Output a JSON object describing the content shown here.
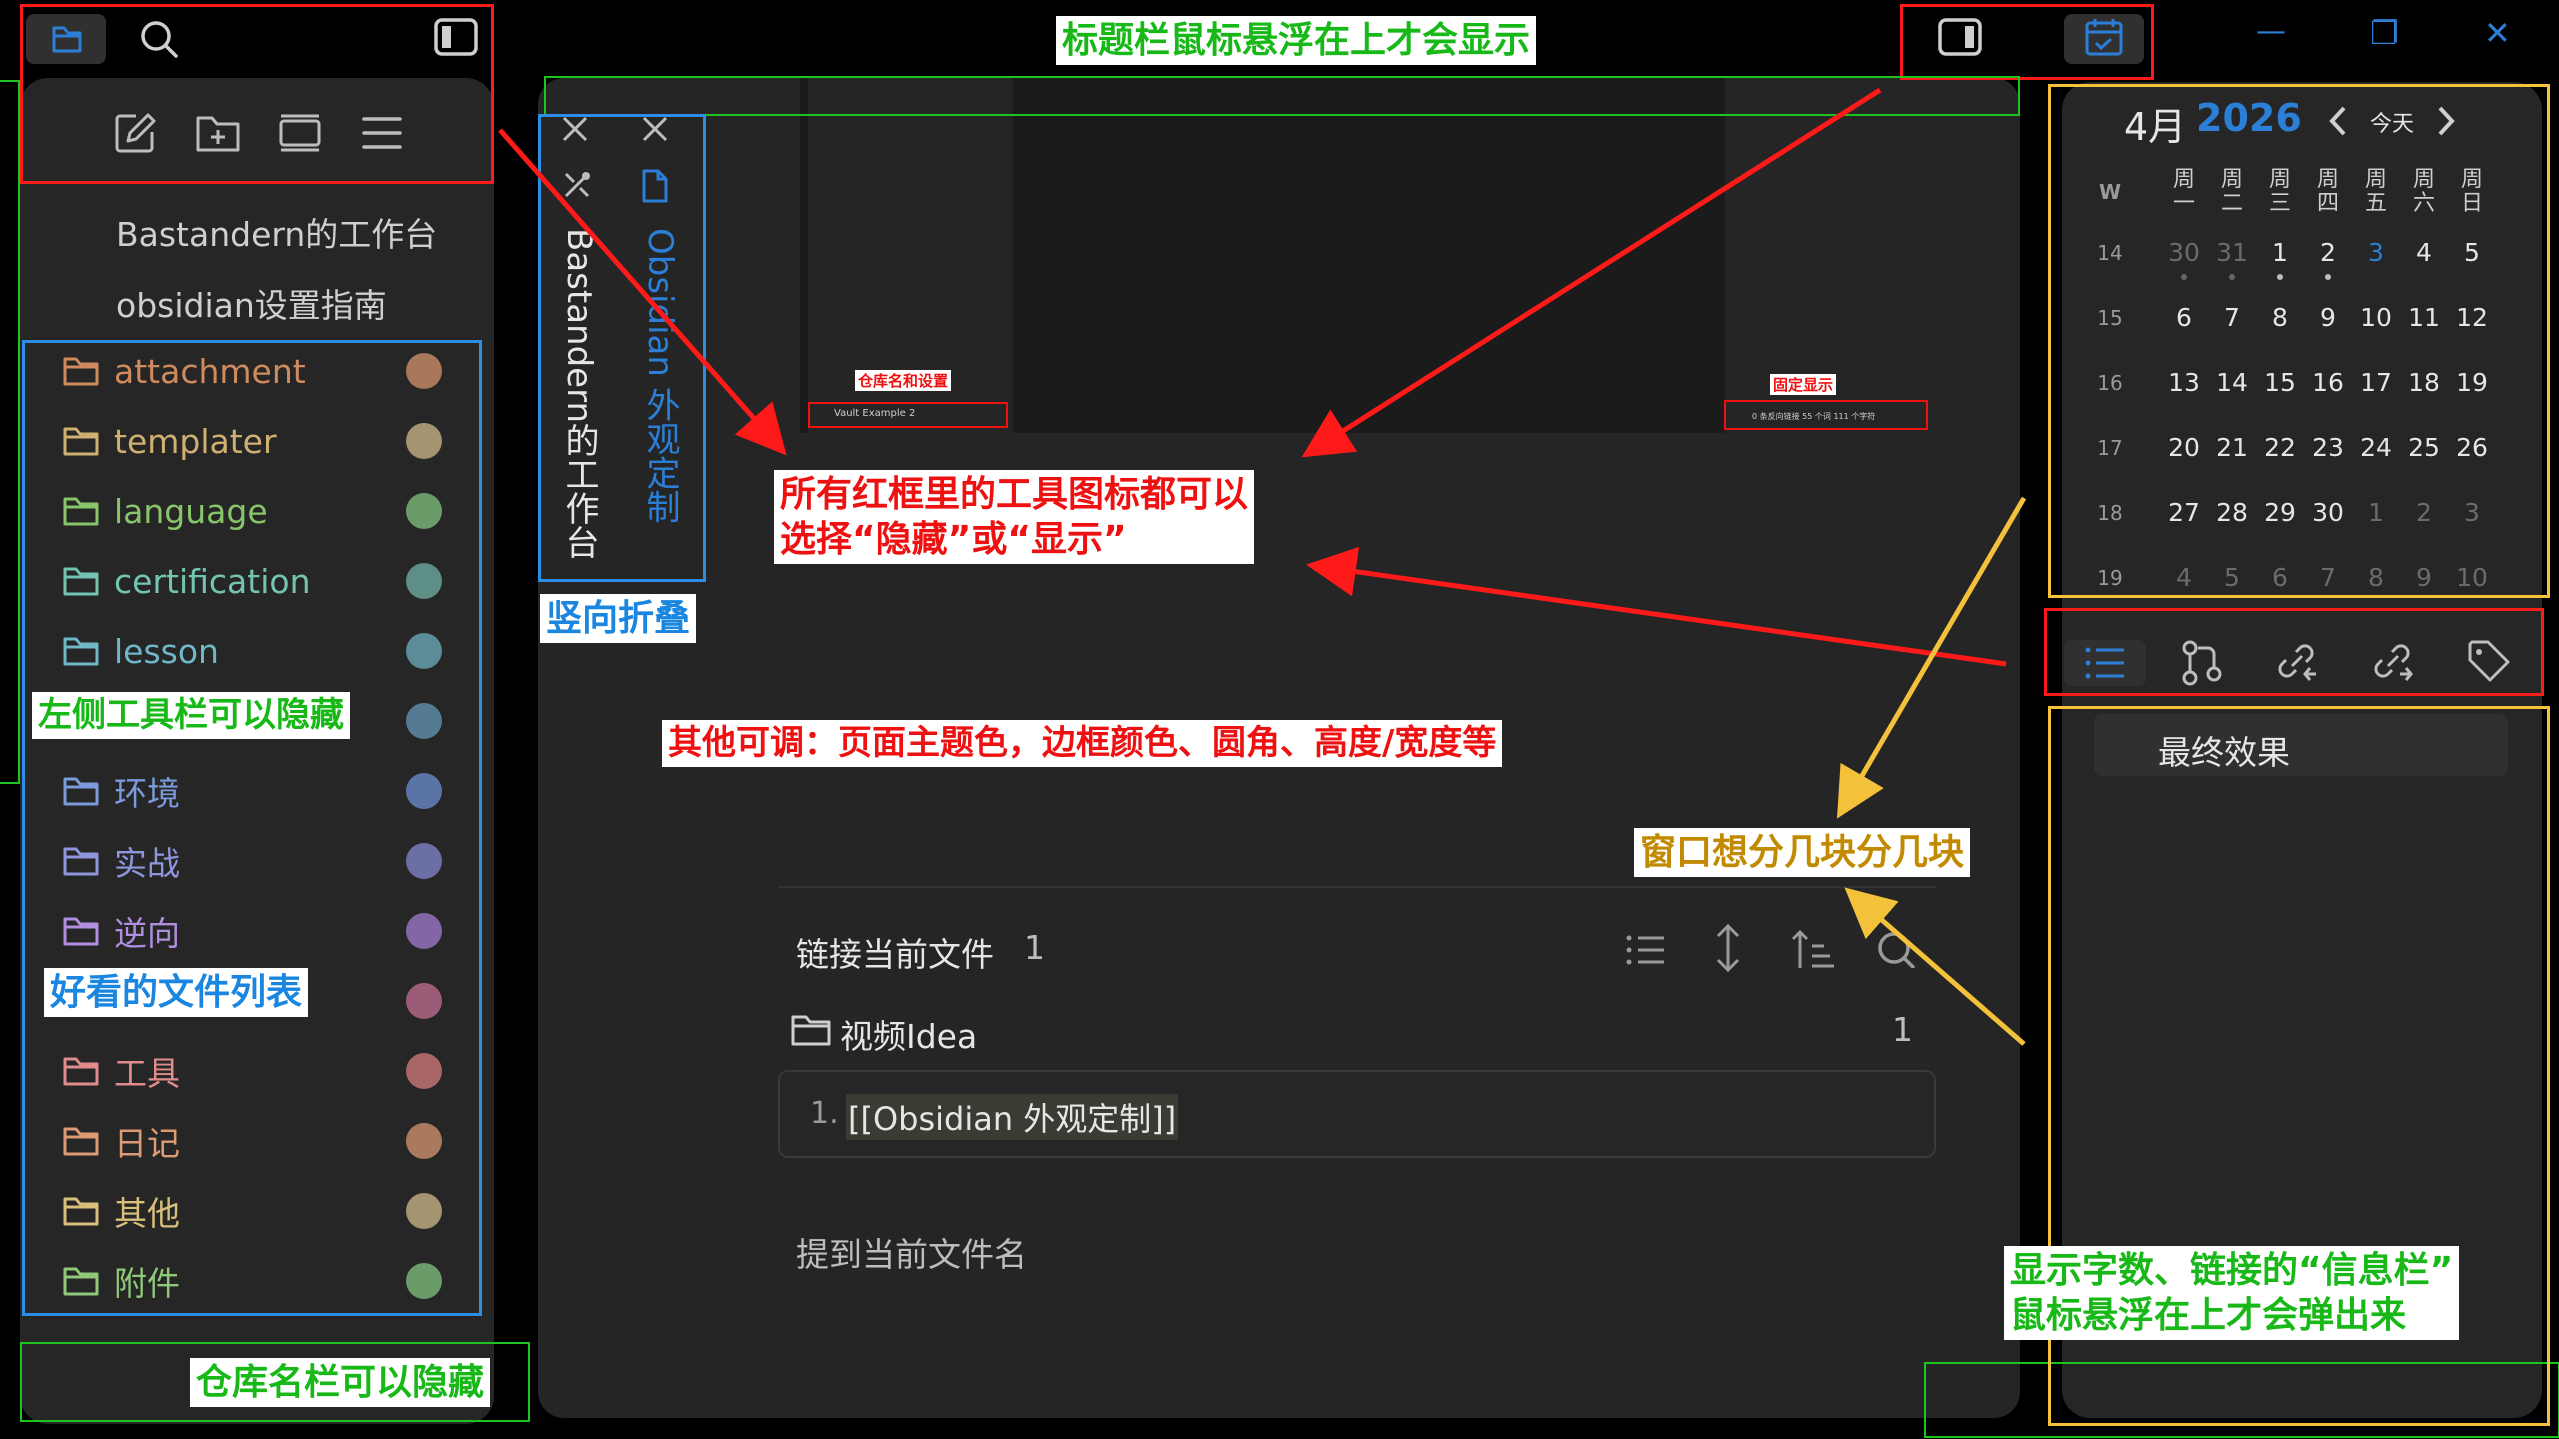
{
  "titlebar_hint": "标题栏鼠标悬浮在上才会显示",
  "window_controls": {
    "minimize": "—",
    "maximize": "❐",
    "close": "✕"
  },
  "left_sidebar": {
    "pinned_files": [
      "Bastandern的工作台",
      "obsidian设置指南"
    ],
    "folders": [
      {
        "name": "attachment",
        "color": "#cf8b5d",
        "dot": "#a9785a"
      },
      {
        "name": "templater",
        "color": "#cfb070",
        "dot": "#a49472"
      },
      {
        "name": "language",
        "color": "#88c46a",
        "dot": "#6c9b6a"
      },
      {
        "name": "certification",
        "color": "#73c4b0",
        "dot": "#5e8f87"
      },
      {
        "name": "lesson",
        "color": "#6fb7c9",
        "dot": "#5b8c98"
      },
      {
        "name": "",
        "color": "#6aa4c9",
        "dot": "#557a93"
      },
      {
        "name": "环境",
        "color": "#7b9bdc",
        "dot": "#5b74a8"
      },
      {
        "name": "实战",
        "color": "#8f96de",
        "dot": "#6b6fa5"
      },
      {
        "name": "逆向",
        "color": "#b08ee0",
        "dot": "#8366a5"
      },
      {
        "name": "",
        "color": "#d07fa8",
        "dot": "#9c5c77"
      },
      {
        "name": "工具",
        "color": "#e08c8c",
        "dot": "#a86666"
      },
      {
        "name": "日记",
        "color": "#dc9b75",
        "dot": "#a97a5d"
      },
      {
        "name": "其他",
        "color": "#d8c07c",
        "dot": "#a49472"
      },
      {
        "name": "附件",
        "color": "#8ec878",
        "dot": "#6c9b6a"
      }
    ]
  },
  "vertical_tabs": {
    "tab1": "Bastandern的工作台",
    "tab2": "Obsidian 外观定制"
  },
  "preview": {
    "label_left": "仓库名和设置",
    "label_right": "固定显示",
    "vault_name": "Vault Example 2",
    "status_text": "0 条反向链接  55 个词  111 个字符"
  },
  "backlinks": {
    "title": "链接当前文件",
    "count": "1",
    "folder": "视频Idea",
    "folder_count": "1",
    "item_num": "1.",
    "item_text": "[[Obsidian 外观定制]]",
    "unlinked_title": "提到当前文件名"
  },
  "calendar": {
    "month": "4月",
    "year": "2026",
    "today_label": "今天",
    "w_label": "W",
    "weekdays": [
      [
        "周",
        "一"
      ],
      [
        "周",
        "二"
      ],
      [
        "周",
        "三"
      ],
      [
        "周",
        "四"
      ],
      [
        "周",
        "五"
      ],
      [
        "周",
        "六"
      ],
      [
        "周",
        "日"
      ]
    ],
    "weeks": [
      {
        "w": "14",
        "days": [
          [
            "30",
            1
          ],
          [
            "31",
            1
          ],
          [
            "1",
            0
          ],
          [
            "2",
            0
          ],
          [
            "3",
            2
          ],
          [
            "4",
            0
          ],
          [
            "5",
            0
          ]
        ]
      },
      {
        "w": "15",
        "days": [
          [
            "6",
            0
          ],
          [
            "7",
            0
          ],
          [
            "8",
            0
          ],
          [
            "9",
            0
          ],
          [
            "10",
            0
          ],
          [
            "11",
            0
          ],
          [
            "12",
            0
          ]
        ]
      },
      {
        "w": "16",
        "days": [
          [
            "13",
            0
          ],
          [
            "14",
            0
          ],
          [
            "15",
            0
          ],
          [
            "16",
            0
          ],
          [
            "17",
            0
          ],
          [
            "18",
            0
          ],
          [
            "19",
            0
          ]
        ]
      },
      {
        "w": "17",
        "days": [
          [
            "20",
            0
          ],
          [
            "21",
            0
          ],
          [
            "22",
            0
          ],
          [
            "23",
            0
          ],
          [
            "24",
            0
          ],
          [
            "25",
            0
          ],
          [
            "26",
            0
          ]
        ]
      },
      {
        "w": "18",
        "days": [
          [
            "27",
            0
          ],
          [
            "28",
            0
          ],
          [
            "29",
            0
          ],
          [
            "30",
            0
          ],
          [
            "1",
            1
          ],
          [
            "2",
            1
          ],
          [
            "3",
            1
          ]
        ]
      },
      {
        "w": "19",
        "days": [
          [
            "4",
            1
          ],
          [
            "5",
            1
          ],
          [
            "6",
            1
          ],
          [
            "7",
            1
          ],
          [
            "8",
            1
          ],
          [
            "9",
            1
          ],
          [
            "10",
            1
          ]
        ]
      }
    ]
  },
  "outline": {
    "heading": "最终效果"
  },
  "annotations": {
    "all_red_hideable": "所有红框里的工具图标都可以\n选择“隐藏”或“显示”",
    "vertical_fold": "竖向折叠",
    "left_toolbar": "左侧工具栏可以隐藏",
    "other_adjust": "其他可调：页面主题色，边框颜色、圆角、高度/宽度等",
    "split_window": "窗口想分几块分几块",
    "nice_file_list": "好看的文件列表",
    "vault_bar": "仓库名栏可以隐藏",
    "status_bar": "显示字数、链接的“信息栏”\n鼠标悬浮在上才会弹出来"
  },
  "colors": {
    "accent": "#2b7fd6",
    "red": "#ff1a1a",
    "green": "#1ec41e",
    "blue": "#2b8de6",
    "yellow": "#f3c13a"
  }
}
